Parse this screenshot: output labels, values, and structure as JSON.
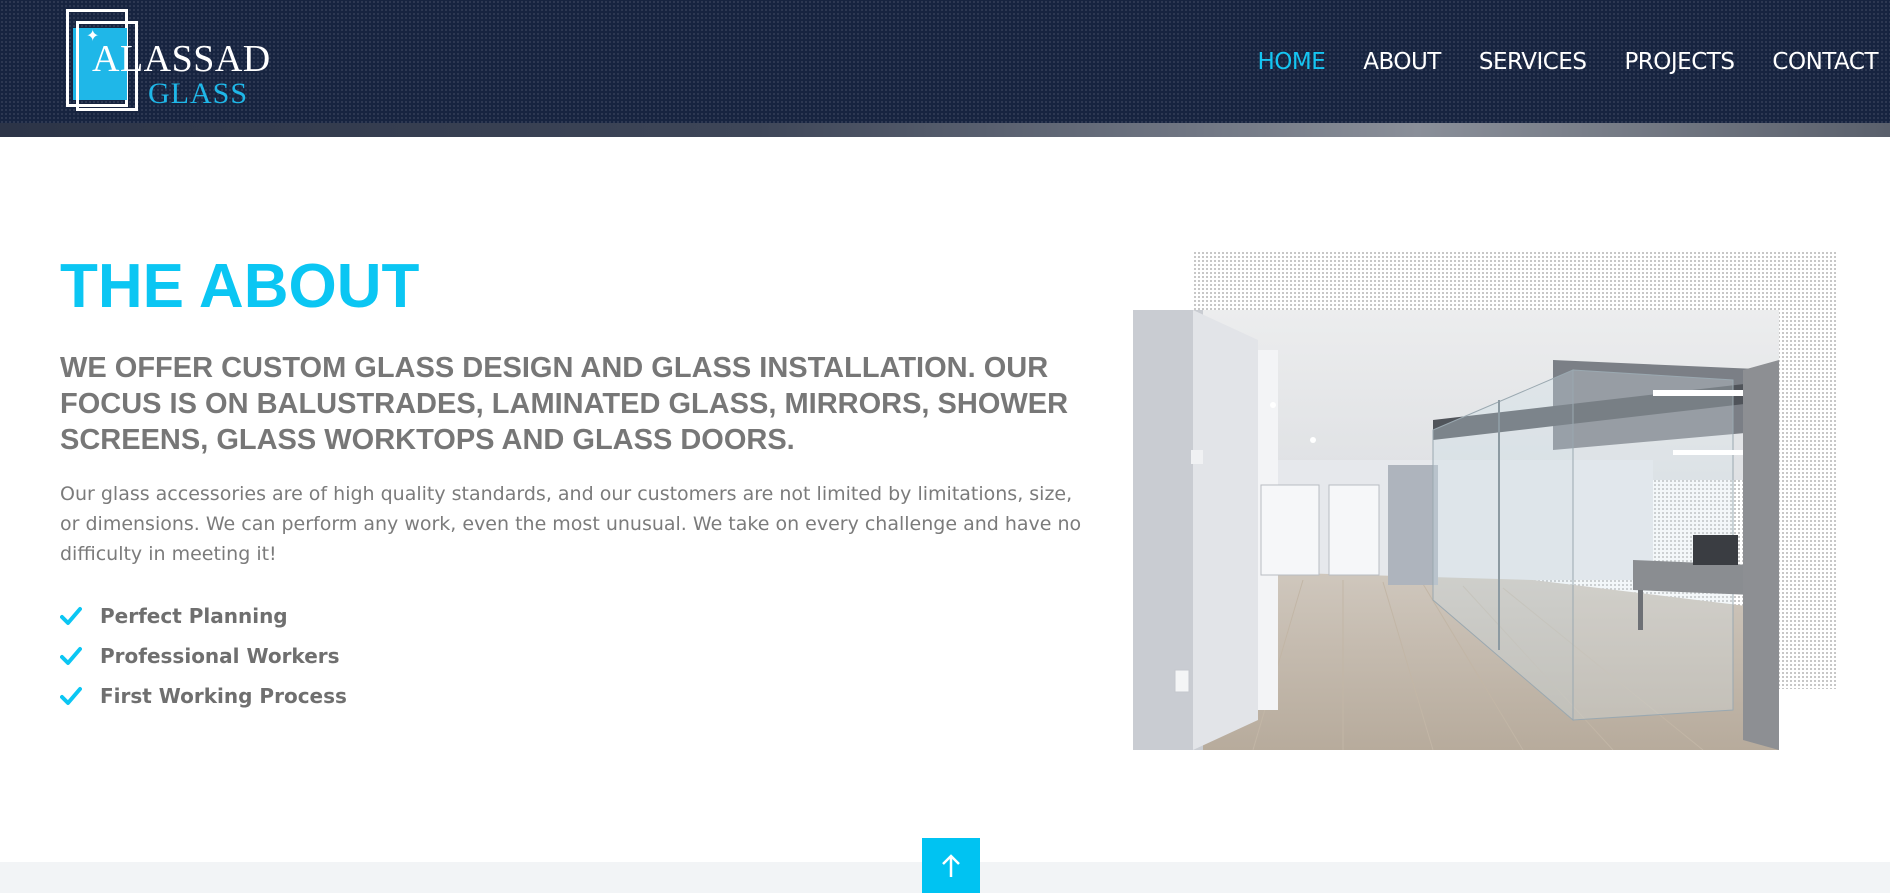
{
  "brand": {
    "name_line1": "ALASSAD",
    "name_line2": "GLASS",
    "accent": "#0bc6f3"
  },
  "nav": {
    "items": [
      {
        "label": "HOME",
        "active": true
      },
      {
        "label": "ABOUT",
        "active": false
      },
      {
        "label": "SERVICES",
        "active": false
      },
      {
        "label": "PROJECTS",
        "active": false
      },
      {
        "label": "CONTACT",
        "active": false
      }
    ]
  },
  "about": {
    "title": "THE ABOUT",
    "subtitle": "WE OFFER CUSTOM GLASS DESIGN AND GLASS INSTALLATION. OUR FOCUS IS ON BALUSTRADES, LAMINATED GLASS, MIRRORS, SHOWER SCREENS, GLASS WORKTOPS AND GLASS DOORS.",
    "body": "Our glass accessories are of high quality standards, and our customers are not limited by limitations, size, or dimensions. We can perform any work, even the most unusual. We take on every challenge and have no difficulty in meeting it!",
    "features": [
      "Perfect Planning",
      "Professional Workers",
      "First Working Process"
    ],
    "image_icon": "office-glass-partition-photo"
  },
  "back_to_top_icon": "arrow-up-icon"
}
